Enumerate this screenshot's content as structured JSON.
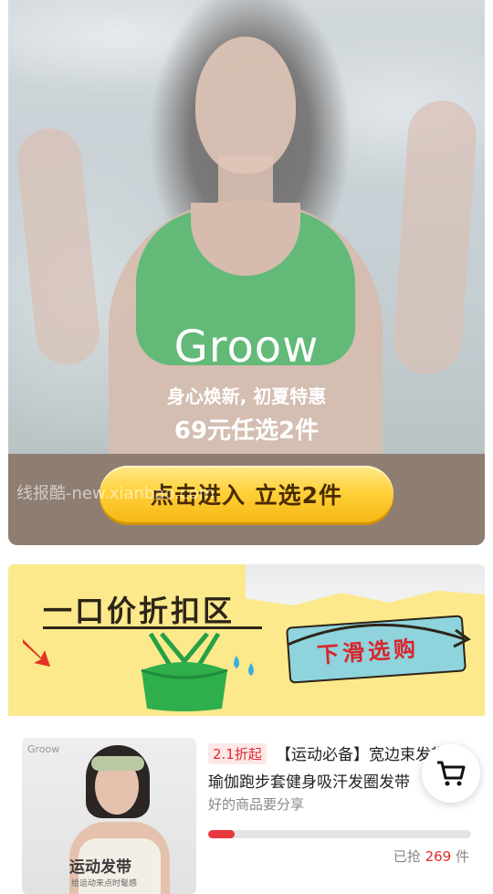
{
  "hero": {
    "brand": "Groow",
    "slogan_line1": "身心焕新, 初夏特惠",
    "slogan_line2": "69元任选2件",
    "cta_label": "点击进入 立选2件",
    "watermark": "线报酷-new.xianbao.com"
  },
  "promo": {
    "title": "一口价折扣区",
    "swipe_label": "下滑选购"
  },
  "product": {
    "image_brand": "Groow",
    "image_caption": "运动发带",
    "image_subcaption": "给运动来点时髦感",
    "discount_badge": "2.1折起",
    "title_line1": "【运动必备】宽边束发带",
    "title_line2": "瑜伽跑步套健身吸汗发圈发带",
    "subtitle": "好的商品要分享",
    "sold_prefix": "已抢",
    "sold_count": "269",
    "sold_suffix": "件",
    "progress": 0.1
  },
  "colors": {
    "accent_red": "#e02a2a",
    "cta_yellow": "#ffd23c",
    "promo_bg": "#fbe98b",
    "bra_green": "#2ea448"
  },
  "icons": {
    "cart": "shopping-cart-icon",
    "arrow": "red-arrow-icon"
  }
}
